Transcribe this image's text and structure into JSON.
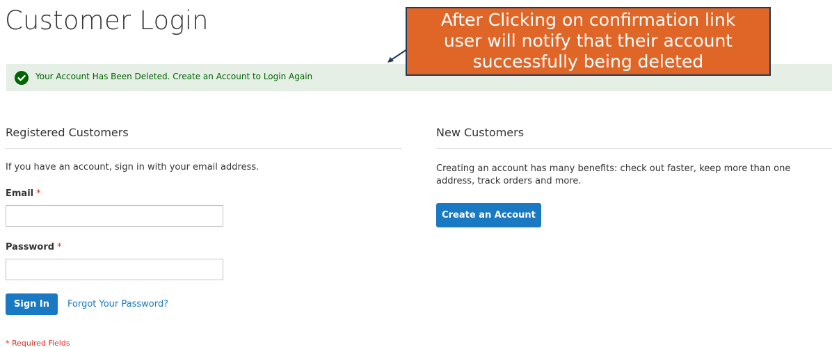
{
  "page": {
    "title": "Customer Login"
  },
  "message": {
    "text": "Your Account Has Been Deleted. Create an Account to Login Again",
    "icon": "check-circle-icon",
    "color": "#006400",
    "background": "#e5efe5"
  },
  "annotation": {
    "line1": "After Clicking on  confirmation link",
    "line2": "user will notify that their account",
    "line3": "successfully being deleted",
    "background": "#e06628",
    "border": "#1f3a5a"
  },
  "registered": {
    "title": "Registered Customers",
    "intro": "If you have an account, sign in with your email address.",
    "email_label": "Email",
    "password_label": "Password",
    "required_marker": "*",
    "email_value": "",
    "password_value": "",
    "sign_in_label": "Sign In",
    "forgot_label": "Forgot Your Password?",
    "required_note": "* Required Fields"
  },
  "new_customers": {
    "title": "New Customers",
    "intro": "Creating an account has many benefits: check out faster, keep more than one address, track orders and more.",
    "create_label": "Create an Account"
  },
  "colors": {
    "primary": "#1979c3",
    "required": "#e02b27",
    "success": "#006400"
  }
}
